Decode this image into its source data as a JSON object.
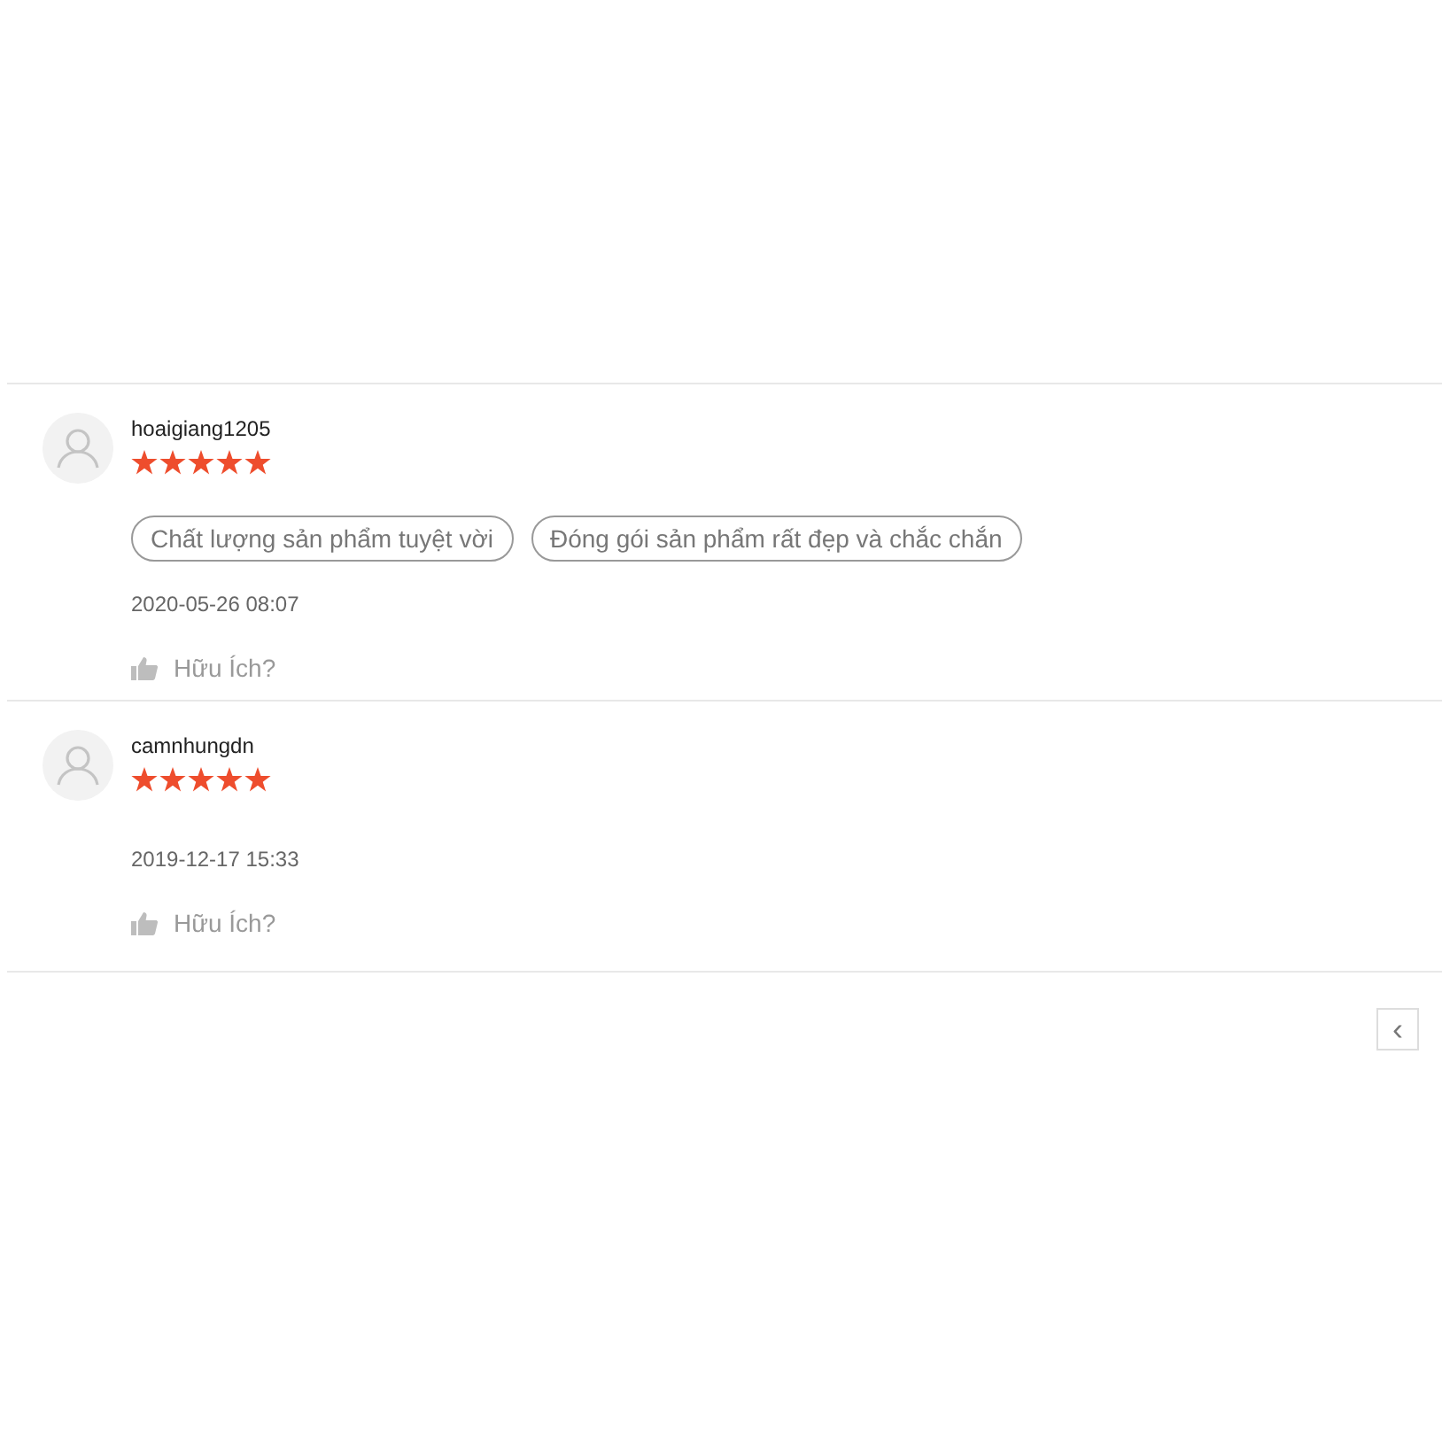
{
  "reviews": [
    {
      "username": "hoaigiang1205",
      "stars": 5,
      "tags": [
        "Chất lượng sản phẩm tuyệt vời",
        "Đóng gói sản phẩm rất đẹp và chắc chắn"
      ],
      "date": "2020-05-26 08:07",
      "helpful": "Hữu Ích?"
    },
    {
      "username": "camnhungdn",
      "stars": 5,
      "date": "2019-12-17 15:33",
      "helpful": "Hữu Ích?"
    }
  ],
  "pagination": {
    "prev_button": "‹"
  }
}
